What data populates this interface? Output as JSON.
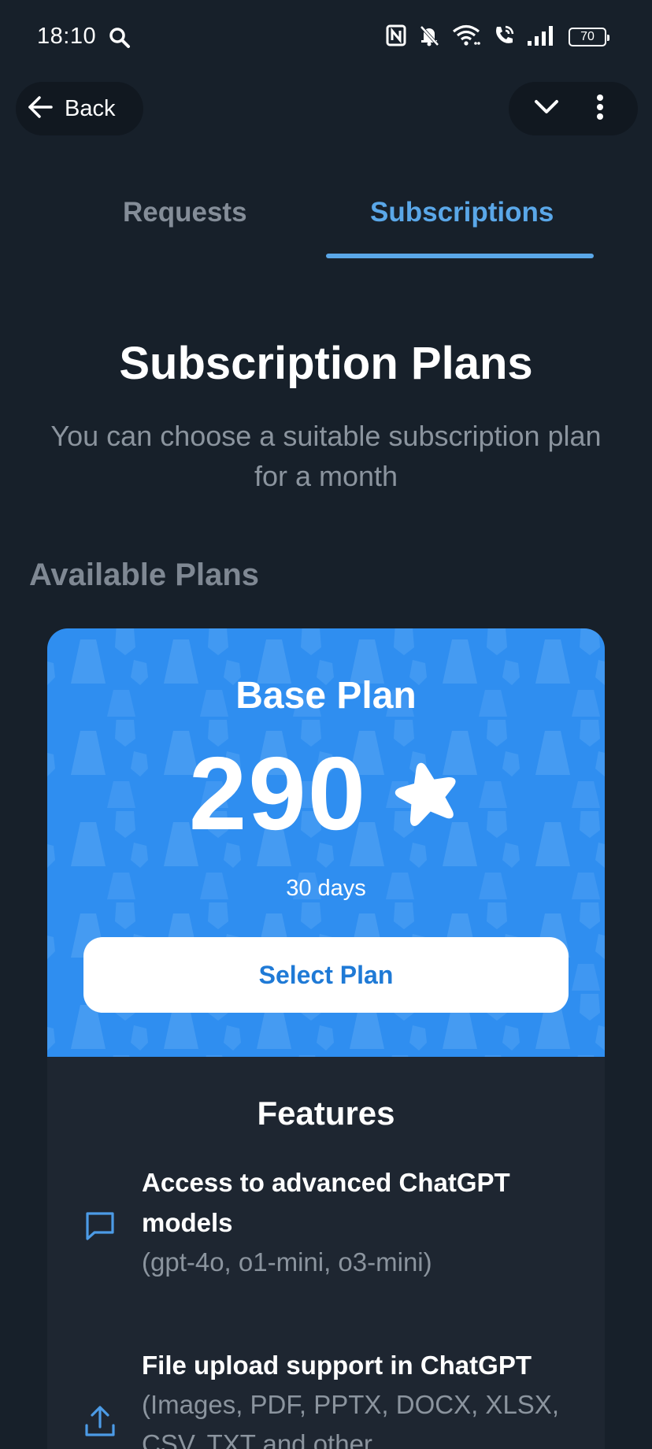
{
  "status_bar": {
    "time": "18:10",
    "battery": "70",
    "icons": [
      "search-icon",
      "nfc-icon",
      "mute-icon",
      "wifi-icon",
      "wifi-call-icon",
      "signal-icon",
      "battery-icon"
    ]
  },
  "nav": {
    "back_label": "Back",
    "actions": [
      "chevron-down-icon",
      "more-vert-icon"
    ]
  },
  "tabs": [
    {
      "label": "Requests",
      "active": false
    },
    {
      "label": "Subscriptions",
      "active": true
    }
  ],
  "header": {
    "title": "Subscription Plans",
    "subtitle": "You can choose a suitable subscription plan for a month"
  },
  "section_title": "Available Plans",
  "plan": {
    "name": "Base Plan",
    "price": "290",
    "currency_icon": "star-icon",
    "duration": "30 days",
    "button_label": "Select Plan",
    "accent_color": "#2f8ef0"
  },
  "features": {
    "title": "Features",
    "items": [
      {
        "icon": "chat-bubble-icon",
        "title": "Access to advanced ChatGPT models",
        "detail": "(gpt-4o, o1-mini, o3-mini)"
      },
      {
        "icon": "upload-icon",
        "title": "File upload support in ChatGPT",
        "detail": "(Images, PDF, PPTX, DOCX, XLSX, CSV, TXT and other"
      }
    ]
  },
  "colors": {
    "background": "#17202a",
    "tab_active": "#5aa7e8",
    "muted_text": "#8b949e"
  }
}
